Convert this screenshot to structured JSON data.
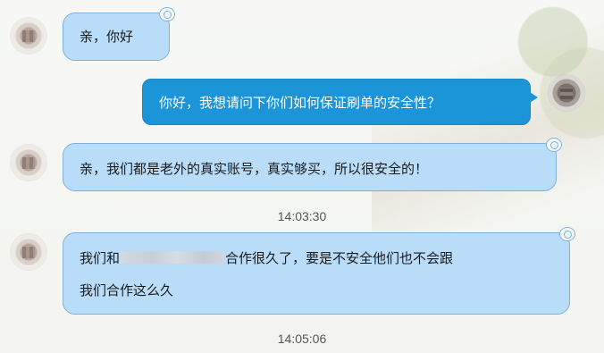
{
  "messages": [
    {
      "side": "left",
      "text": "亲，你好"
    },
    {
      "side": "right",
      "text": "你好，我想请问下你们如何保证刷单的安全性？"
    },
    {
      "side": "left",
      "text": "亲，我们都是老外的真实账号，真实够买，所以很安全的！"
    },
    {
      "timestamp": "14:03:30"
    },
    {
      "side": "left",
      "text_before": "我们和",
      "text_after": "合作很久了，要是不安全他们也不会跟",
      "line2": "我们合作这么久"
    },
    {
      "timestamp": "14:05:06"
    }
  ],
  "colors": {
    "self_bubble": "#1b95d8",
    "other_bubble": "#b9dcf8",
    "other_bubble_border": "#7fb0dc"
  }
}
